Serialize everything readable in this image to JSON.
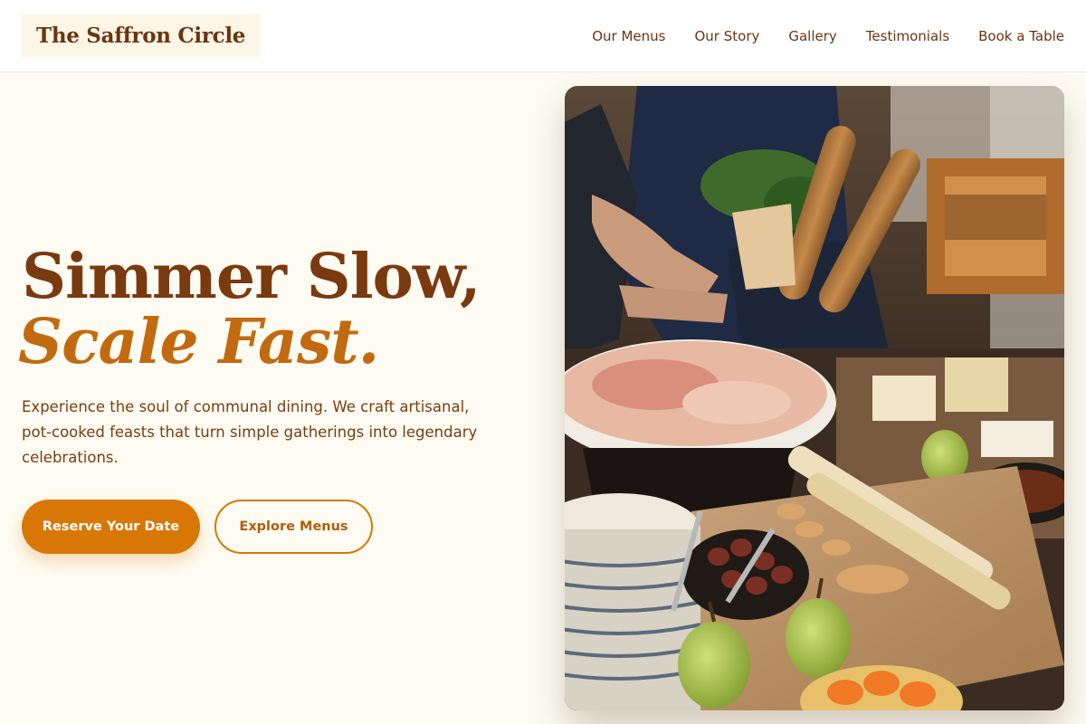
{
  "nav": {
    "brand": "The Saffron Circle",
    "links": [
      "Our Menus",
      "Our Story",
      "Gallery",
      "Testimonials",
      "Book a Table"
    ]
  },
  "hero": {
    "headline_line1": "Simmer Slow,",
    "headline_line2": "Scale Fast.",
    "description": "Experience the soul of communal dining. We craft artisanal, pot-cooked feasts that turn simple gatherings into legendary celebrations.",
    "primary_button": "Reserve Your Date",
    "secondary_button": "Explore Menus"
  },
  "colors": {
    "background": "#fefcf2",
    "brand_brown": "#7a3a10",
    "accent_orange": "#d97706",
    "italic_orange": "#c26a10"
  }
}
